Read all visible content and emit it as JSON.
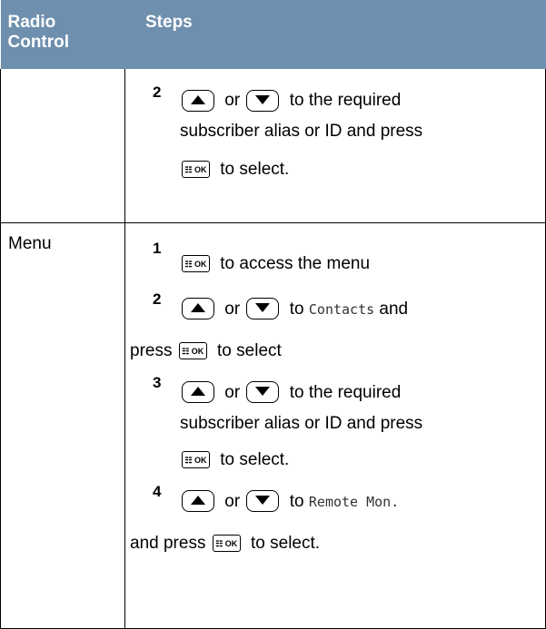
{
  "header": {
    "col1": "Radio\nControl",
    "col1_a": "Radio",
    "col1_b": "Control",
    "col2": "Steps"
  },
  "rows": [
    {
      "control": "",
      "steps": [
        {
          "num": "2",
          "or": "or",
          "text1": "to the required",
          "text2": "subscriber alias or ID and press",
          "ok_label": "OK",
          "text3": "to select."
        }
      ]
    },
    {
      "control": "Menu",
      "steps": [
        {
          "num": "1",
          "ok_label": "OK",
          "text": "to access the menu"
        },
        {
          "num": "2",
          "or": "or",
          "text_a": "to",
          "mono": "Contacts",
          "text_b": "and",
          "text_c": "press",
          "ok_label": "OK",
          "text_d": "to select"
        },
        {
          "num": "3",
          "or": "or",
          "text1": "to the required",
          "text2": "subscriber alias or ID and press",
          "ok_label": "OK",
          "text3": "to select."
        },
        {
          "num": "4",
          "or": "or",
          "text_a": "to",
          "mono": "Remote Mon.",
          "text_c": "and press",
          "ok_label": "OK",
          "text_d": "to select."
        }
      ]
    }
  ],
  "icons": {
    "up": "up-arrow-key-icon",
    "down": "down-arrow-key-icon",
    "ok": "menu-ok-key-icon"
  }
}
